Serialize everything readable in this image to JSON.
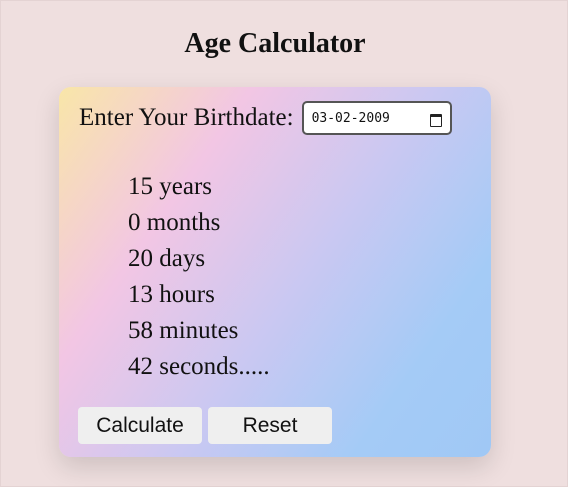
{
  "page": {
    "title": "Age Calculator"
  },
  "form": {
    "birth_label": "Enter Your Birthdate:",
    "birthdate_value": "03-02-2009",
    "calendar_icon": "calendar-icon"
  },
  "results": [
    "15 years",
    "0 months",
    "20 days",
    "13 hours",
    "58 minutes",
    "42 seconds....."
  ],
  "buttons": {
    "calculate_label": "Calculate",
    "reset_label": "Reset"
  },
  "colors": {
    "page_background": "#efdfdf",
    "card_gradient": [
      "#f9e6a8",
      "#f2c6e4",
      "#c9c8f2",
      "#a4cbf6"
    ],
    "button_background": "#efefef"
  }
}
